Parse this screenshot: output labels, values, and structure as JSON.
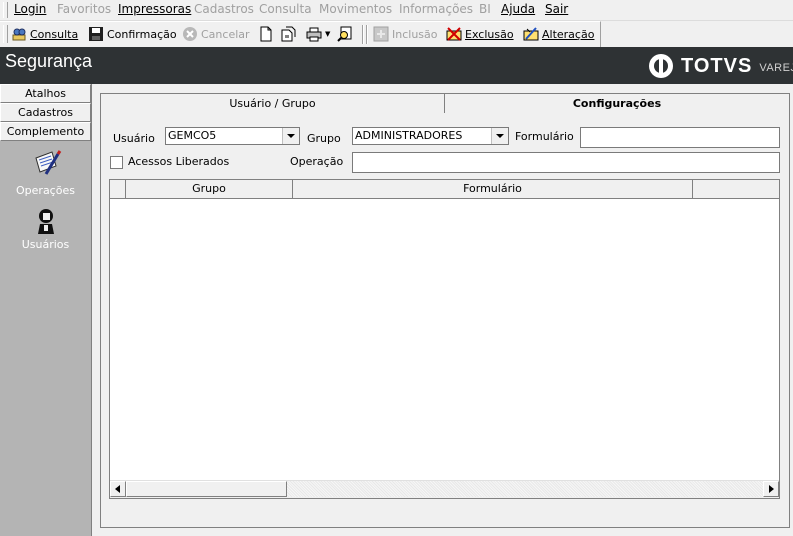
{
  "menu": [
    {
      "label": "Login",
      "disabled": false
    },
    {
      "label": "Favoritos",
      "disabled": true
    },
    {
      "label": "Impressoras",
      "disabled": false
    },
    {
      "label": "Cadastros",
      "disabled": true
    },
    {
      "label": "Consulta",
      "disabled": true
    },
    {
      "label": "Movimentos",
      "disabled": true
    },
    {
      "label": "Informações",
      "disabled": true
    },
    {
      "label": "BI",
      "disabled": true
    },
    {
      "label": "Ajuda",
      "disabled": false
    },
    {
      "label": "Sair",
      "disabled": false
    }
  ],
  "toolbar": {
    "consulta": "Consulta",
    "confirmacao": "Confirmação",
    "cancelar": "Cancelar",
    "inclusao": "Inclusão",
    "exclusao": "Exclusão",
    "alteracao": "Alteração"
  },
  "title": "Segurança",
  "logo": {
    "name": "TOTVS",
    "sub": "VAREJO"
  },
  "sidebar": {
    "tabs": [
      "Atalhos",
      "Cadastros",
      "Complemento"
    ],
    "entries": [
      {
        "label": "Operações",
        "icon": "operations-icon"
      },
      {
        "label": "Usuários",
        "icon": "users-icon"
      }
    ]
  },
  "tabs": [
    {
      "label": "Usuário  / Grupo",
      "active": false
    },
    {
      "label": "Configurações",
      "active": true
    }
  ],
  "form": {
    "usuario_label": "Usuário",
    "usuario_value": "GEMCO5",
    "grupo_label": "Grupo",
    "grupo_value": "ADMINISTRADORES",
    "formulario_label": "Formulário",
    "formulario_value": "",
    "acessos_label": "Acessos Liberados",
    "acessos_checked": false,
    "operacao_label": "Operação",
    "operacao_value": ""
  },
  "grid": {
    "columns": [
      "",
      "Grupo",
      "Formulário",
      ""
    ],
    "rows": []
  }
}
